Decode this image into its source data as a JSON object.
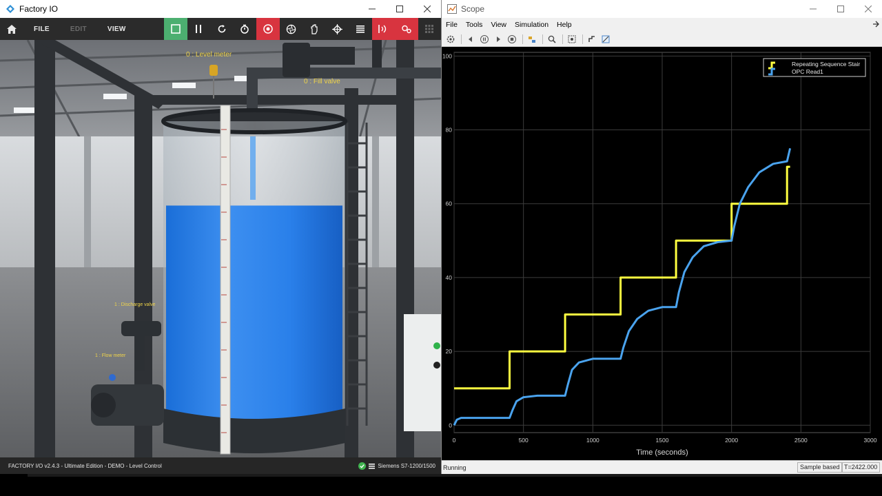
{
  "factory_io": {
    "title": "Factory IO",
    "menu": {
      "file": "FILE",
      "edit": "EDIT",
      "view": "VIEW"
    },
    "scene_labels": {
      "level_meter": "0 : Level meter",
      "fill_valve": "0 : Fill valve",
      "discharge_valve": "1 : Discharge valve",
      "flow_meter": "1 : Flow meter"
    },
    "tank_level": 0.72,
    "status_left": "FACTORY I/O v2.4.3 - Ultimate Edition - DEMO - Level Control",
    "status_right": "Siemens S7-1200/1500"
  },
  "scope": {
    "title": "Scope",
    "menu": [
      "File",
      "Tools",
      "View",
      "Simulation",
      "Help"
    ],
    "status_left": "Running",
    "sample_mode": "Sample based",
    "time_readout": "T=2422.000"
  },
  "colors": {
    "yellow": "#ffff40",
    "blue": "#4aa3ee",
    "green_btn": "#4caf70",
    "red_btn": "#d8343f"
  },
  "chart_data": {
    "type": "line",
    "xlabel": "Time (seconds)",
    "ylabel": "",
    "xlim": [
      0,
      3000
    ],
    "ylim": [
      -2,
      101
    ],
    "xticks": [
      0,
      500,
      1000,
      1500,
      2000,
      2500,
      3000
    ],
    "yticks": [
      0,
      20,
      40,
      60,
      80,
      100
    ],
    "grid": true,
    "legend_position": "top-right",
    "series": [
      {
        "name": "Repeating Sequence Stair",
        "color": "#ffff40",
        "x": [
          0,
          400,
          400,
          800,
          800,
          1200,
          1200,
          1600,
          1600,
          2000,
          2000,
          2400,
          2400,
          2422
        ],
        "y": [
          10,
          10,
          20,
          20,
          30,
          30,
          40,
          40,
          50,
          50,
          60,
          60,
          70,
          70
        ]
      },
      {
        "name": "OPC Read1",
        "color": "#4aa3ee",
        "x": [
          0,
          20,
          50,
          150,
          300,
          400,
          420,
          450,
          500,
          600,
          700,
          800,
          820,
          850,
          900,
          1000,
          1100,
          1200,
          1220,
          1260,
          1320,
          1400,
          1500,
          1600,
          1620,
          1660,
          1720,
          1800,
          1900,
          2000,
          2020,
          2060,
          2120,
          2200,
          2300,
          2400,
          2422
        ],
        "y": [
          0,
          1.5,
          2,
          2,
          2,
          2,
          4,
          6.5,
          7.6,
          8,
          8,
          8,
          11,
          15,
          17,
          18,
          18,
          18,
          21,
          25.5,
          28.8,
          31,
          32,
          32,
          36,
          41.5,
          45.5,
          48.5,
          49.6,
          50,
          54,
          60,
          64.5,
          68.5,
          70.8,
          71.5,
          75
        ]
      }
    ]
  }
}
